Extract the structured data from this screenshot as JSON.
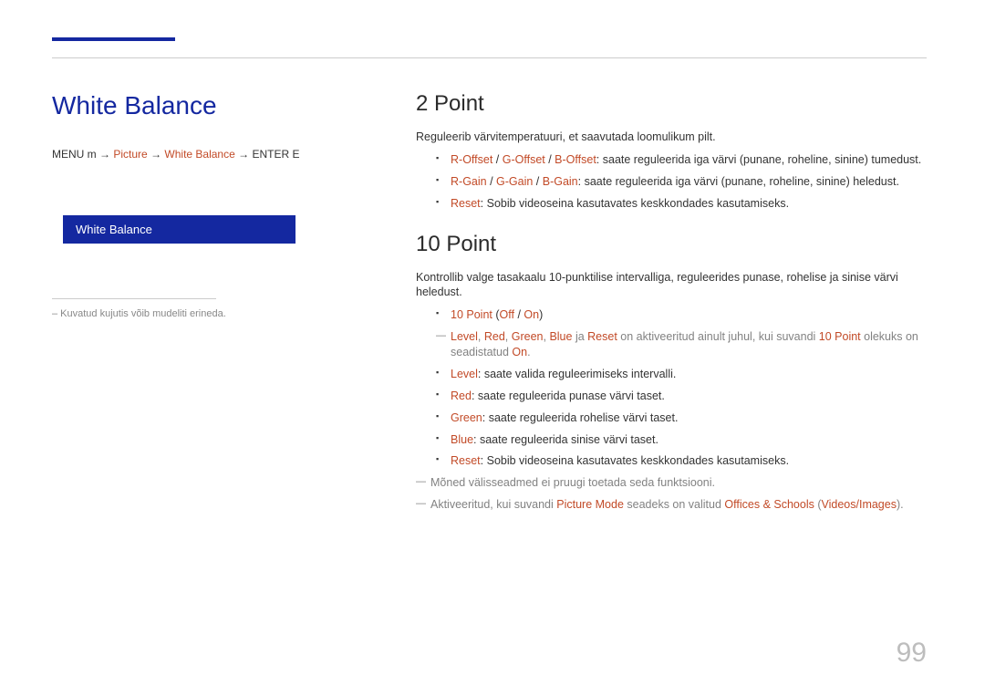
{
  "left": {
    "title": "White Balance",
    "breadcrumb": {
      "menu": "MENU m",
      "arrow": "→",
      "p1": "Picture",
      "p2": "White Balance",
      "enter": "ENTER E"
    },
    "menuItem": "White Balance",
    "footnote": "– Kuvatud kujutis võib mudeliti erineda."
  },
  "sections": {
    "twoPoint": {
      "heading": "2 Point",
      "intro": "Reguleerib värvitemperatuuri, et saavutada loomulikum pilt.",
      "items": {
        "offsets": {
          "r": "R-Offset",
          "g": "G-Offset",
          "b": "B-Offset",
          "rest": ": saate reguleerida iga värvi (punane, roheline, sinine) tumedust."
        },
        "gains": {
          "r": "R-Gain",
          "g": "G-Gain",
          "b": "B-Gain",
          "rest": ": saate reguleerida iga värvi (punane, roheline, sinine) heledust."
        },
        "reset": {
          "label": "Reset",
          "rest": ": Sobib videoseina kasutavates keskkondades kasutamiseks."
        }
      }
    },
    "tenPoint": {
      "heading": "10 Point",
      "intro": "Kontrollib valge tasakaalu 10-punktilise intervalliga, reguleerides punase, rohelise ja sinise värvi heledust.",
      "items": {
        "toggle": {
          "label": "10 Point",
          "lp": "(",
          "off": "Off",
          "sep": " / ",
          "on": "On",
          "rp": ")"
        },
        "coloredNote": {
          "l": "Level",
          "c1": ", ",
          "r": "Red",
          "c2": ", ",
          "g": "Green",
          "c3": ", ",
          "b": "Blue",
          "ja": " ja ",
          "reset": "Reset",
          "mid": " on aktiveeritud ainult juhul, kui suvandi ",
          "tp": "10 Point",
          "tail": " olekuks on seadistatud ",
          "onw": "On",
          "dot": "."
        },
        "level": {
          "label": "Level",
          "rest": ": saate valida reguleerimiseks intervalli."
        },
        "red": {
          "label": "Red",
          "rest": ": saate reguleerida punase värvi taset."
        },
        "green": {
          "label": "Green",
          "rest": ": saate reguleerida rohelise värvi taset."
        },
        "blue": {
          "label": "Blue",
          "rest": ": saate reguleerida sinise värvi taset."
        },
        "reset": {
          "label": "Reset",
          "rest": ": Sobib videoseina kasutavates keskkondades kasutamiseks."
        }
      },
      "note1": "Mõned välisseadmed ei pruugi toetada seda funktsiooni.",
      "note2": {
        "pre": "Aktiveeritud, kui suvandi ",
        "pm": "Picture Mode",
        "mid": " seadeks on valitud ",
        "os": "Offices & Schools",
        "lp": " (",
        "vi": "Videos/Images",
        "rp": ")."
      }
    }
  },
  "pageNumber": "99"
}
